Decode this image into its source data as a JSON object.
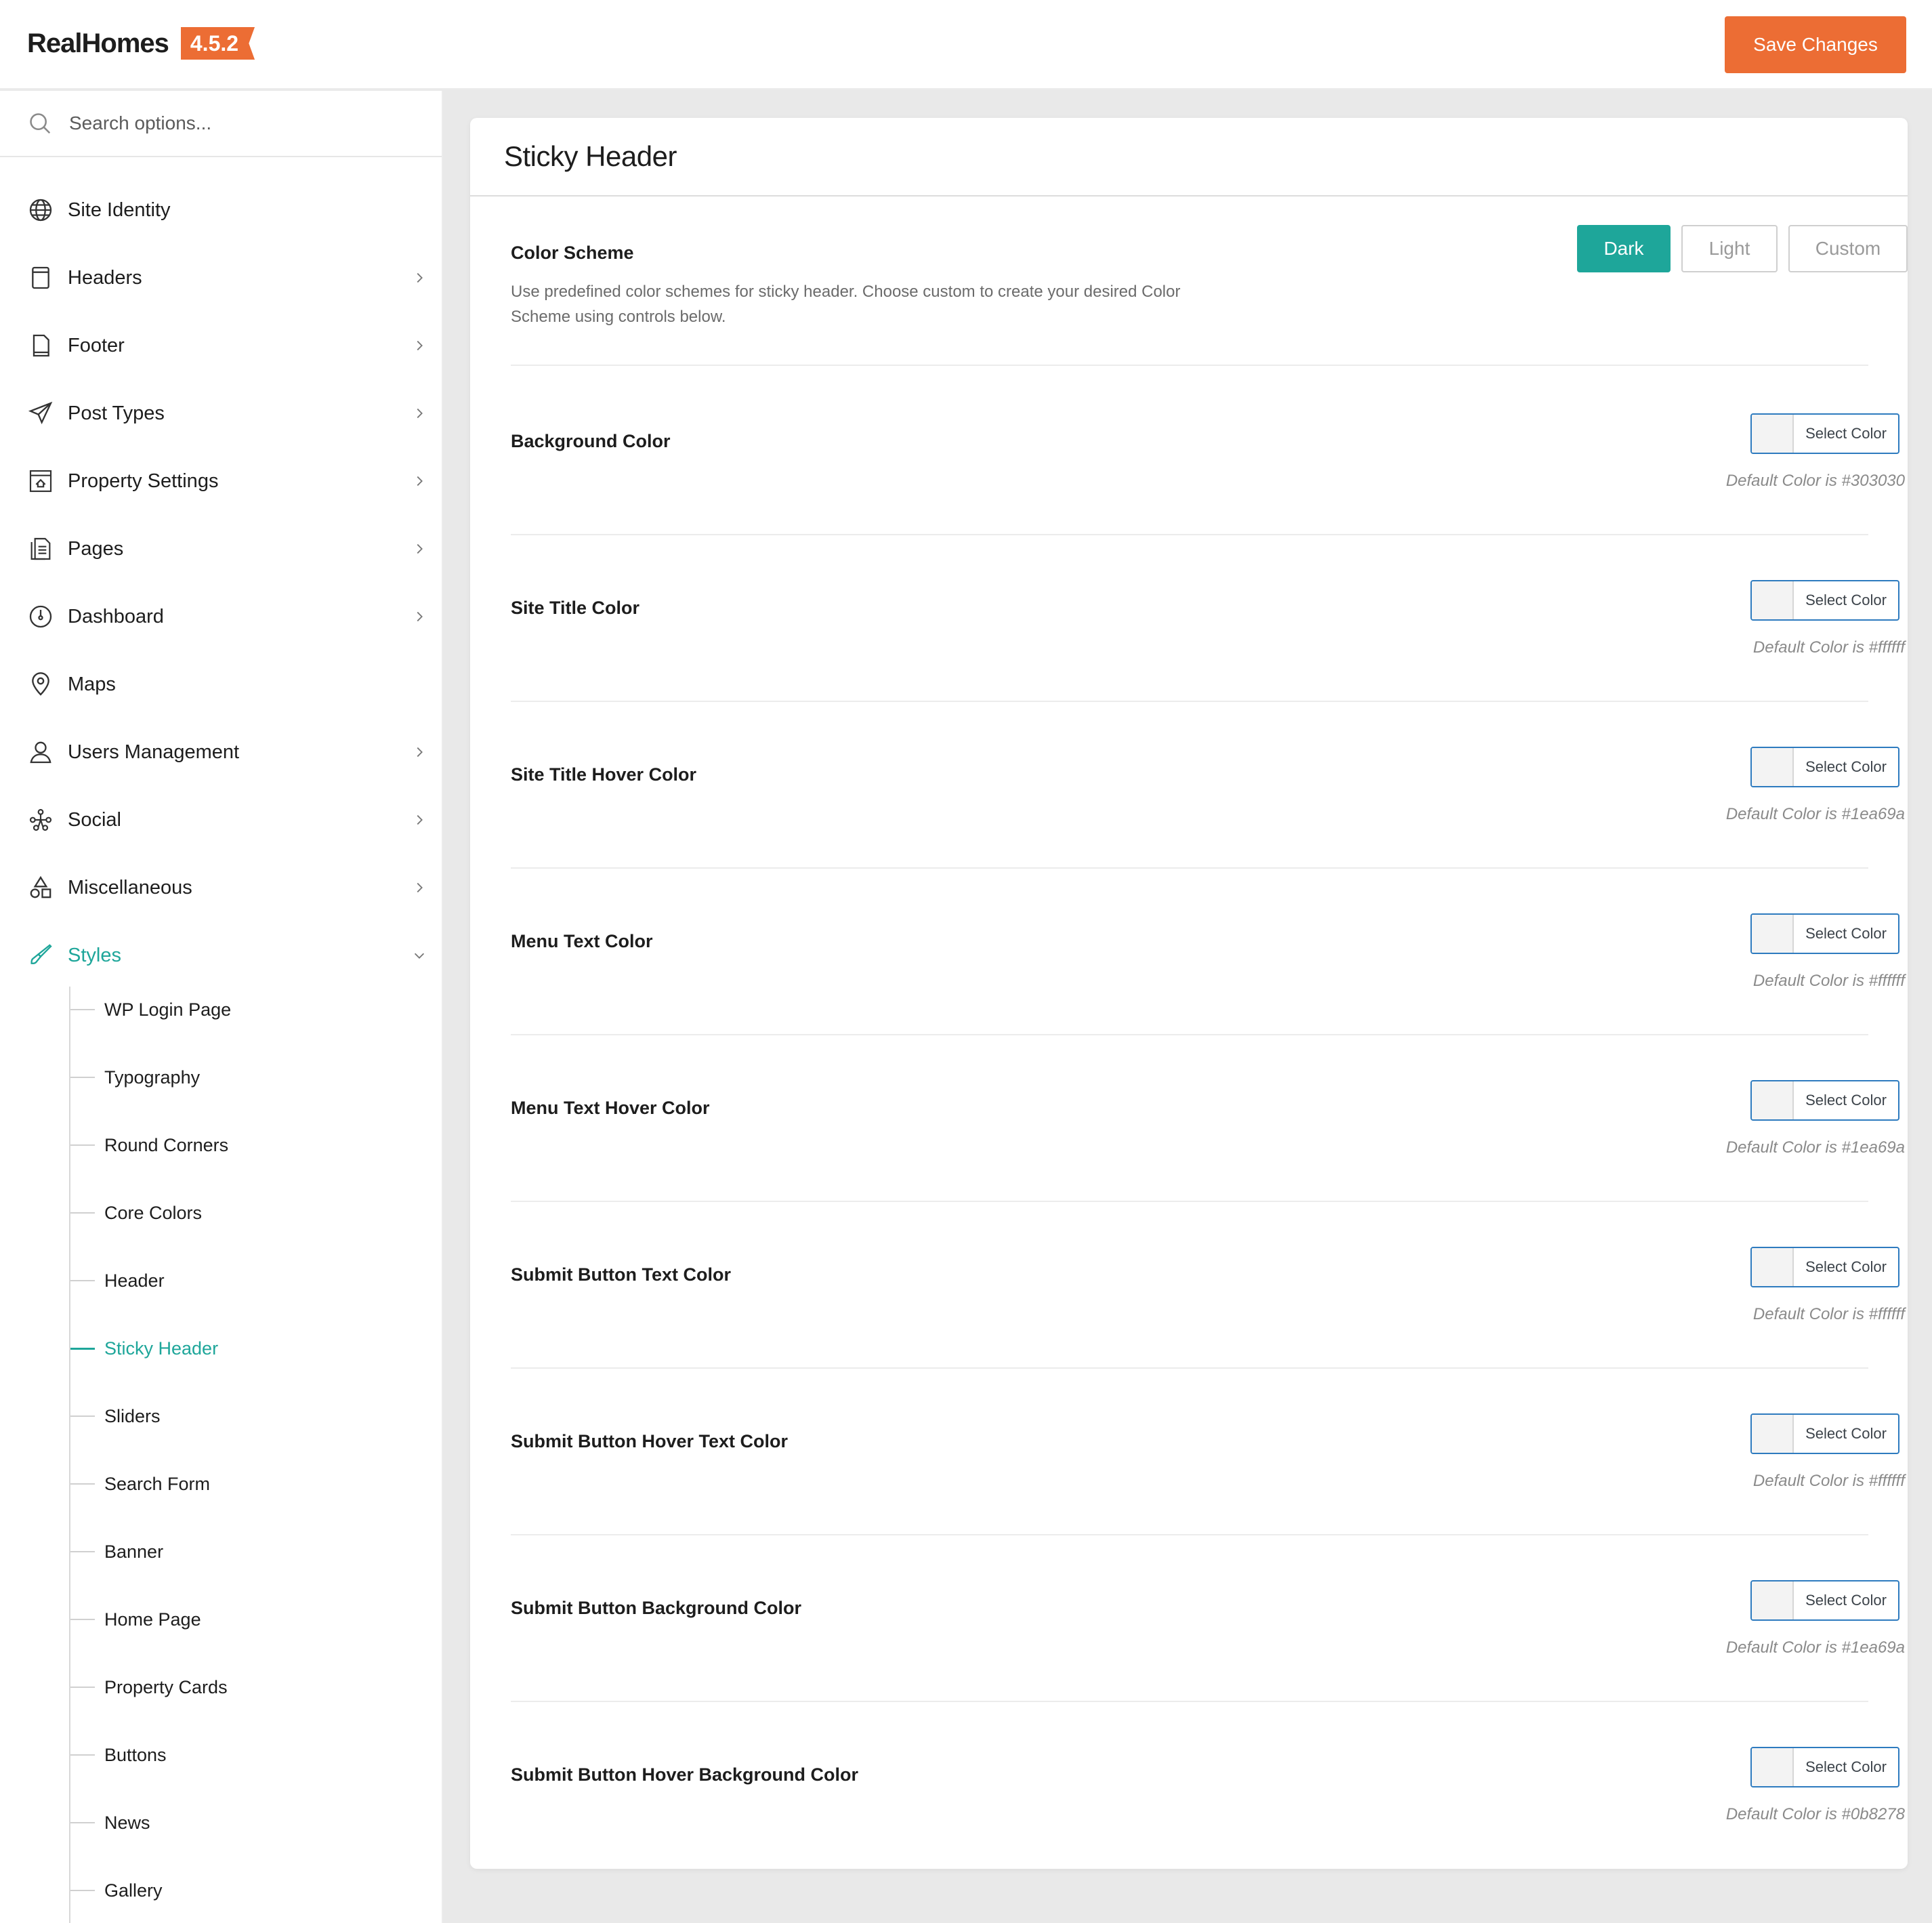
{
  "header": {
    "brand": "RealHomes",
    "version": "4.5.2",
    "save_label": "Save Changes",
    "accent": "#ec6d34"
  },
  "search": {
    "placeholder": "Search options..."
  },
  "sidebar": {
    "items": [
      {
        "label": "Site Identity",
        "icon": "globe-icon",
        "has_children": false
      },
      {
        "label": "Headers",
        "icon": "header-page-icon",
        "has_children": true
      },
      {
        "label": "Footer",
        "icon": "footer-page-icon",
        "has_children": true
      },
      {
        "label": "Post Types",
        "icon": "paper-plane-icon",
        "has_children": true
      },
      {
        "label": "Property Settings",
        "icon": "property-window-icon",
        "has_children": true
      },
      {
        "label": "Pages",
        "icon": "pages-icon",
        "has_children": true
      },
      {
        "label": "Dashboard",
        "icon": "gauge-icon",
        "has_children": true
      },
      {
        "label": "Maps",
        "icon": "map-pin-icon",
        "has_children": false
      },
      {
        "label": "Users Management",
        "icon": "user-icon",
        "has_children": true
      },
      {
        "label": "Social",
        "icon": "social-network-icon",
        "has_children": true
      },
      {
        "label": "Miscellaneous",
        "icon": "shapes-icon",
        "has_children": true
      },
      {
        "label": "Styles",
        "icon": "brush-icon",
        "has_children": true,
        "expanded": true
      }
    ],
    "styles_children": [
      "WP Login Page",
      "Typography",
      "Round Corners",
      "Core Colors",
      "Header",
      "Sticky Header",
      "Sliders",
      "Search Form",
      "Banner",
      "Home Page",
      "Property Cards",
      "Buttons",
      "News",
      "Gallery"
    ],
    "active_child": "Sticky Header",
    "active_color": "#1ea69a"
  },
  "main": {
    "title": "Sticky Header",
    "color_scheme": {
      "label": "Color Scheme",
      "description": "Use predefined color schemes for sticky header. Choose custom to create your desired Color Scheme using controls below.",
      "options": [
        "Dark",
        "Light",
        "Custom"
      ],
      "selected": "Dark"
    },
    "picker_label": "Select Color",
    "color_fields": [
      {
        "label": "Background Color",
        "default_note": "Default Color is #303030"
      },
      {
        "label": "Site Title Color",
        "default_note": "Default Color is #ffffff"
      },
      {
        "label": "Site Title Hover Color",
        "default_note": "Default Color is #1ea69a"
      },
      {
        "label": "Menu Text Color",
        "default_note": "Default Color is #ffffff"
      },
      {
        "label": "Menu Text Hover Color",
        "default_note": "Default Color is #1ea69a"
      },
      {
        "label": "Submit Button Text Color",
        "default_note": "Default Color is #ffffff"
      },
      {
        "label": "Submit Button Hover Text Color",
        "default_note": "Default Color is #ffffff"
      },
      {
        "label": "Submit Button Background Color",
        "default_note": "Default Color is #1ea69a"
      },
      {
        "label": "Submit Button Hover Background Color",
        "default_note": "Default Color is #0b8278"
      }
    ]
  }
}
